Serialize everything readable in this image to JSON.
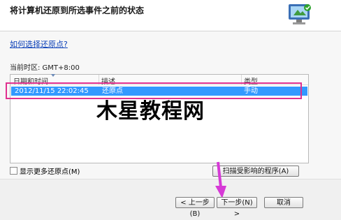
{
  "header": {
    "title": "将计算机还原到所选事件之前的状态"
  },
  "link": {
    "text": "如何选择还原点?"
  },
  "timezone": {
    "text": "当前时区: GMT+8:00"
  },
  "table": {
    "columns": [
      "日期和时间",
      "描述",
      "类型"
    ],
    "rows": [
      {
        "datetime": "2012/11/15 22:02:45",
        "description": "还原点",
        "type": "手动"
      }
    ]
  },
  "watermark": {
    "text": "木星教程网"
  },
  "options": {
    "show_more_label": "显示更多还原点(M)"
  },
  "buttons": {
    "scan_label": "扫描受影响的程序(A)",
    "back_label": "< 上一步(B)",
    "next_label": "下一步(N) >",
    "cancel_label": "取消"
  },
  "colors": {
    "selection": "#3399ff",
    "highlight_frame": "#e0308f",
    "arrow": "#d63ad6"
  }
}
